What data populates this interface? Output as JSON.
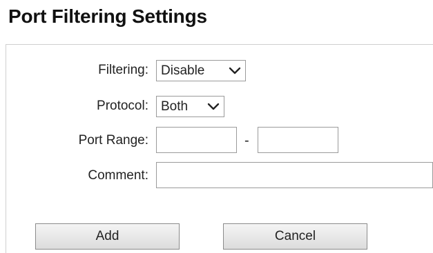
{
  "page": {
    "title": "Port Filtering Settings"
  },
  "form": {
    "filtering": {
      "label": "Filtering:",
      "value": "Disable"
    },
    "protocol": {
      "label": "Protocol:",
      "value": "Both"
    },
    "port_range": {
      "label": "Port Range:",
      "start_value": "",
      "separator": "-",
      "end_value": ""
    },
    "comment": {
      "label": "Comment:",
      "value": ""
    }
  },
  "buttons": {
    "add_label": "Add",
    "cancel_label": "Cancel"
  },
  "icons": {
    "dropdown": "chevron-down-icon"
  },
  "colors": {
    "border": "#9a9a9a",
    "button_top": "#f4f4f4",
    "button_bottom": "#dcdcdc"
  }
}
